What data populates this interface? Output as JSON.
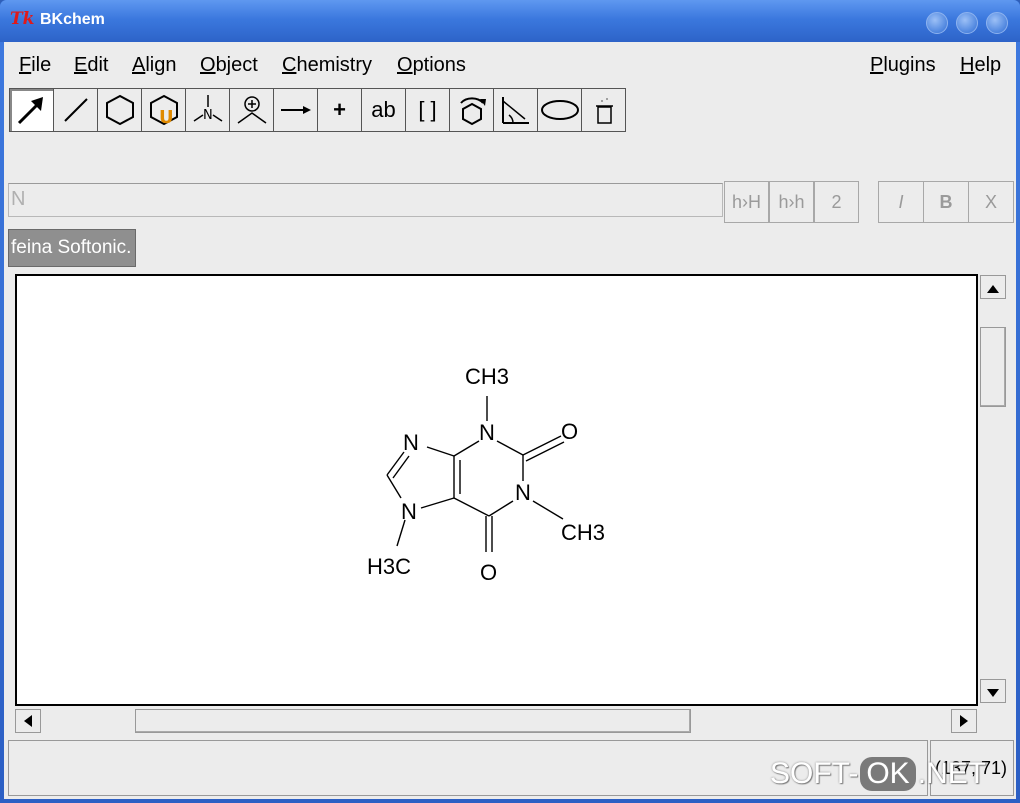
{
  "window": {
    "logo": "Tk",
    "title": "BKchem"
  },
  "menubar": {
    "items": [
      "File",
      "Edit",
      "Align",
      "Object",
      "Chemistry",
      "Options"
    ],
    "right_items": [
      "Plugins",
      "Help"
    ]
  },
  "toolbar": {
    "tools": [
      {
        "name": "edit-mode-arrow-icon",
        "label": ""
      },
      {
        "name": "draw-bond-icon",
        "label": ""
      },
      {
        "name": "template-hexagon-icon",
        "label": ""
      },
      {
        "name": "user-template-icon",
        "label": ""
      },
      {
        "name": "group-nitrogen-icon",
        "label": ""
      },
      {
        "name": "charge-plus-icon",
        "label": ""
      },
      {
        "name": "reaction-arrow-icon",
        "label": ""
      },
      {
        "name": "plus-icon",
        "label": "+"
      },
      {
        "name": "text-icon",
        "label": "ab"
      },
      {
        "name": "brackets-icon",
        "label": "[ ]"
      },
      {
        "name": "rotate-icon",
        "label": ""
      },
      {
        "name": "bond-align-icon",
        "label": ""
      },
      {
        "name": "ellipse-icon",
        "label": ""
      },
      {
        "name": "vector-trash-icon",
        "label": ""
      }
    ]
  },
  "entry": {
    "value": "N"
  },
  "format_buttons": {
    "subscript_hh": "h›H",
    "superscript_hh": "h›h",
    "numbering": "2",
    "italic": "I",
    "bold": "B",
    "subscript": "X"
  },
  "tab": {
    "label": "feina Softonic."
  },
  "molecule": {
    "labels": {
      "n3_methyl": "CH3",
      "n1_methyl": "CH3",
      "n7_methyl": "H3C",
      "n9": "N",
      "n7": "N",
      "n3": "N",
      "n1": "N",
      "o2": "O",
      "o6": "O"
    }
  },
  "status": {
    "coords": "(137, 71)"
  },
  "watermark": {
    "left": "SOFT-",
    "ok": "OK",
    "right": ".NET"
  }
}
